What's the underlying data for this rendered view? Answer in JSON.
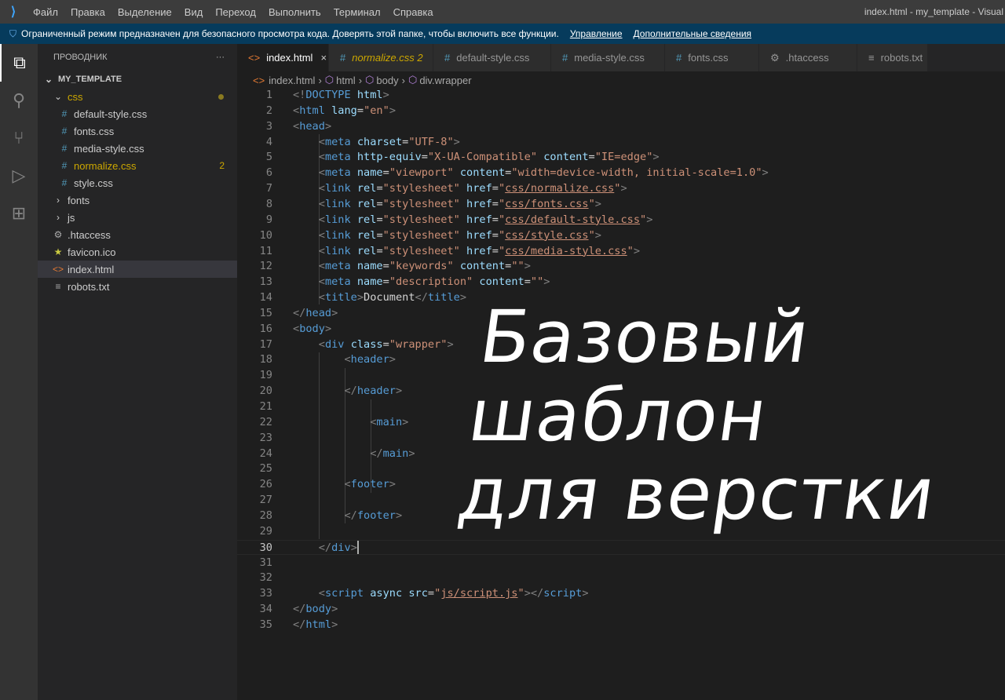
{
  "titlebar": {
    "menu": [
      "Файл",
      "Правка",
      "Выделение",
      "Вид",
      "Переход",
      "Выполнить",
      "Терминал",
      "Справка"
    ],
    "title": "index.html - my_template - Visual"
  },
  "banner": {
    "text": "Ограниченный режим предназначен для безопасного просмотра кода. Доверять этой папке, чтобы включить все функции.",
    "manage": "Управление",
    "more": "Дополнительные сведения"
  },
  "sidebar": {
    "title": "ПРОВОДНИК",
    "more": "···",
    "root": "MY_TEMPLATE",
    "items": [
      {
        "label": "css",
        "kind": "folder-open",
        "level": 1,
        "modified": true
      },
      {
        "label": "default-style.css",
        "kind": "css",
        "level": 2
      },
      {
        "label": "fonts.css",
        "kind": "css",
        "level": 2
      },
      {
        "label": "media-style.css",
        "kind": "css",
        "level": 2
      },
      {
        "label": "normalize.css",
        "kind": "css",
        "level": 2,
        "badge": "2"
      },
      {
        "label": "style.css",
        "kind": "css",
        "level": 2
      },
      {
        "label": "fonts",
        "kind": "folder",
        "level": 1
      },
      {
        "label": "js",
        "kind": "folder",
        "level": 1
      },
      {
        "label": ".htaccess",
        "kind": "gear",
        "level": 1
      },
      {
        "label": "favicon.ico",
        "kind": "star",
        "level": 1
      },
      {
        "label": "index.html",
        "kind": "html",
        "level": 1,
        "selected": true
      },
      {
        "label": "robots.txt",
        "kind": "txt",
        "level": 1
      }
    ]
  },
  "tabs": [
    {
      "label": "index.html",
      "icon": "html",
      "active": true,
      "close": "×"
    },
    {
      "label": "normalize.css 2",
      "icon": "css",
      "modified": true
    },
    {
      "label": "default-style.css",
      "icon": "css"
    },
    {
      "label": "media-style.css",
      "icon": "css"
    },
    {
      "label": "fonts.css",
      "icon": "css"
    },
    {
      "label": ".htaccess",
      "icon": "gear"
    },
    {
      "label": "robots.txt",
      "icon": "txt"
    }
  ],
  "breadcrumb": [
    "index.html",
    "html",
    "body",
    "div.wrapper"
  ],
  "editor": {
    "current_line": 30,
    "lines": [
      [
        [
          "b",
          "<!"
        ],
        [
          "t",
          "DOCTYPE"
        ],
        [
          "p",
          " "
        ],
        [
          "a",
          "html"
        ],
        [
          "b",
          ">"
        ]
      ],
      [
        [
          "b",
          "<"
        ],
        [
          "t",
          "html"
        ],
        [
          "p",
          " "
        ],
        [
          "a",
          "lang"
        ],
        [
          "p",
          "="
        ],
        [
          "s",
          "\"en\""
        ],
        [
          "b",
          ">"
        ]
      ],
      [
        [
          "b",
          "<"
        ],
        [
          "t",
          "head"
        ],
        [
          "b",
          ">"
        ]
      ],
      [
        [
          "p",
          "    "
        ],
        [
          "b",
          "<"
        ],
        [
          "t",
          "meta"
        ],
        [
          "p",
          " "
        ],
        [
          "a",
          "charset"
        ],
        [
          "p",
          "="
        ],
        [
          "s",
          "\"UTF-8\""
        ],
        [
          "b",
          ">"
        ]
      ],
      [
        [
          "p",
          "    "
        ],
        [
          "b",
          "<"
        ],
        [
          "t",
          "meta"
        ],
        [
          "p",
          " "
        ],
        [
          "a",
          "http-equiv"
        ],
        [
          "p",
          "="
        ],
        [
          "s",
          "\"X-UA-Compatible\""
        ],
        [
          "p",
          " "
        ],
        [
          "a",
          "content"
        ],
        [
          "p",
          "="
        ],
        [
          "s",
          "\"IE=edge\""
        ],
        [
          "b",
          ">"
        ]
      ],
      [
        [
          "p",
          "    "
        ],
        [
          "b",
          "<"
        ],
        [
          "t",
          "meta"
        ],
        [
          "p",
          " "
        ],
        [
          "a",
          "name"
        ],
        [
          "p",
          "="
        ],
        [
          "s",
          "\"viewport\""
        ],
        [
          "p",
          " "
        ],
        [
          "a",
          "content"
        ],
        [
          "p",
          "="
        ],
        [
          "s",
          "\"width=device-width, initial-scale=1.0\""
        ],
        [
          "b",
          ">"
        ]
      ],
      [
        [
          "p",
          "    "
        ],
        [
          "b",
          "<"
        ],
        [
          "t",
          "link"
        ],
        [
          "p",
          " "
        ],
        [
          "a",
          "rel"
        ],
        [
          "p",
          "="
        ],
        [
          "s",
          "\"stylesheet\""
        ],
        [
          "p",
          " "
        ],
        [
          "a",
          "href"
        ],
        [
          "p",
          "="
        ],
        [
          "s",
          "\""
        ],
        [
          "u",
          "css/normalize.css"
        ],
        [
          "s",
          "\""
        ],
        [
          "b",
          ">"
        ]
      ],
      [
        [
          "p",
          "    "
        ],
        [
          "b",
          "<"
        ],
        [
          "t",
          "link"
        ],
        [
          "p",
          " "
        ],
        [
          "a",
          "rel"
        ],
        [
          "p",
          "="
        ],
        [
          "s",
          "\"stylesheet\""
        ],
        [
          "p",
          " "
        ],
        [
          "a",
          "href"
        ],
        [
          "p",
          "="
        ],
        [
          "s",
          "\""
        ],
        [
          "u",
          "css/fonts.css"
        ],
        [
          "s",
          "\""
        ],
        [
          "b",
          ">"
        ]
      ],
      [
        [
          "p",
          "    "
        ],
        [
          "b",
          "<"
        ],
        [
          "t",
          "link"
        ],
        [
          "p",
          " "
        ],
        [
          "a",
          "rel"
        ],
        [
          "p",
          "="
        ],
        [
          "s",
          "\"stylesheet\""
        ],
        [
          "p",
          " "
        ],
        [
          "a",
          "href"
        ],
        [
          "p",
          "="
        ],
        [
          "s",
          "\""
        ],
        [
          "u",
          "css/default-style.css"
        ],
        [
          "s",
          "\""
        ],
        [
          "b",
          ">"
        ]
      ],
      [
        [
          "p",
          "    "
        ],
        [
          "b",
          "<"
        ],
        [
          "t",
          "link"
        ],
        [
          "p",
          " "
        ],
        [
          "a",
          "rel"
        ],
        [
          "p",
          "="
        ],
        [
          "s",
          "\"stylesheet\""
        ],
        [
          "p",
          " "
        ],
        [
          "a",
          "href"
        ],
        [
          "p",
          "="
        ],
        [
          "s",
          "\""
        ],
        [
          "u",
          "css/style.css"
        ],
        [
          "s",
          "\""
        ],
        [
          "b",
          ">"
        ]
      ],
      [
        [
          "p",
          "    "
        ],
        [
          "b",
          "<"
        ],
        [
          "t",
          "link"
        ],
        [
          "p",
          " "
        ],
        [
          "a",
          "rel"
        ],
        [
          "p",
          "="
        ],
        [
          "s",
          "\"stylesheet\""
        ],
        [
          "p",
          " "
        ],
        [
          "a",
          "href"
        ],
        [
          "p",
          "="
        ],
        [
          "s",
          "\""
        ],
        [
          "u",
          "css/media-style.css"
        ],
        [
          "s",
          "\""
        ],
        [
          "b",
          ">"
        ]
      ],
      [
        [
          "p",
          "    "
        ],
        [
          "b",
          "<"
        ],
        [
          "t",
          "meta"
        ],
        [
          "p",
          " "
        ],
        [
          "a",
          "name"
        ],
        [
          "p",
          "="
        ],
        [
          "s",
          "\"keywords\""
        ],
        [
          "p",
          " "
        ],
        [
          "a",
          "content"
        ],
        [
          "p",
          "="
        ],
        [
          "s",
          "\"\""
        ],
        [
          "b",
          ">"
        ]
      ],
      [
        [
          "p",
          "    "
        ],
        [
          "b",
          "<"
        ],
        [
          "t",
          "meta"
        ],
        [
          "p",
          " "
        ],
        [
          "a",
          "name"
        ],
        [
          "p",
          "="
        ],
        [
          "s",
          "\"description\""
        ],
        [
          "p",
          " "
        ],
        [
          "a",
          "content"
        ],
        [
          "p",
          "="
        ],
        [
          "s",
          "\"\""
        ],
        [
          "b",
          ">"
        ]
      ],
      [
        [
          "p",
          "    "
        ],
        [
          "b",
          "<"
        ],
        [
          "t",
          "title"
        ],
        [
          "b",
          ">"
        ],
        [
          "p",
          "Document"
        ],
        [
          "b",
          "</"
        ],
        [
          "t",
          "title"
        ],
        [
          "b",
          ">"
        ]
      ],
      [
        [
          "b",
          "</"
        ],
        [
          "t",
          "head"
        ],
        [
          "b",
          ">"
        ]
      ],
      [
        [
          "b",
          "<"
        ],
        [
          "t",
          "body"
        ],
        [
          "b",
          ">"
        ]
      ],
      [
        [
          "p",
          "    "
        ],
        [
          "b",
          "<"
        ],
        [
          "t",
          "div"
        ],
        [
          "p",
          " "
        ],
        [
          "a",
          "class"
        ],
        [
          "p",
          "="
        ],
        [
          "s",
          "\"wrapper\""
        ],
        [
          "b",
          ">"
        ]
      ],
      [
        [
          "p",
          "        "
        ],
        [
          "b",
          "<"
        ],
        [
          "t",
          "header"
        ],
        [
          "b",
          ">"
        ]
      ],
      [],
      [
        [
          "p",
          "        "
        ],
        [
          "b",
          "</"
        ],
        [
          "t",
          "header"
        ],
        [
          "b",
          ">"
        ]
      ],
      [],
      [
        [
          "p",
          "            "
        ],
        [
          "b",
          "<"
        ],
        [
          "t",
          "main"
        ],
        [
          "b",
          ">"
        ]
      ],
      [],
      [
        [
          "p",
          "            "
        ],
        [
          "b",
          "</"
        ],
        [
          "t",
          "main"
        ],
        [
          "b",
          ">"
        ]
      ],
      [],
      [
        [
          "p",
          "        "
        ],
        [
          "b",
          "<"
        ],
        [
          "t",
          "footer"
        ],
        [
          "b",
          ">"
        ]
      ],
      [],
      [
        [
          "p",
          "        "
        ],
        [
          "b",
          "</"
        ],
        [
          "t",
          "footer"
        ],
        [
          "b",
          ">"
        ]
      ],
      [],
      [
        [
          "p",
          "    "
        ],
        [
          "b",
          "</"
        ],
        [
          "t",
          "div"
        ],
        [
          "b",
          ">"
        ]
      ],
      [],
      [],
      [
        [
          "p",
          "    "
        ],
        [
          "b",
          "<"
        ],
        [
          "t",
          "script"
        ],
        [
          "p",
          " "
        ],
        [
          "a",
          "async"
        ],
        [
          "p",
          " "
        ],
        [
          "a",
          "src"
        ],
        [
          "p",
          "="
        ],
        [
          "s",
          "\""
        ],
        [
          "u",
          "js/script.js"
        ],
        [
          "s",
          "\""
        ],
        [
          "b",
          "></"
        ],
        [
          "t",
          "script"
        ],
        [
          "b",
          ">"
        ]
      ],
      [
        [
          "b",
          "</"
        ],
        [
          "t",
          "body"
        ],
        [
          "b",
          ">"
        ]
      ],
      [
        [
          "b",
          "</"
        ],
        [
          "t",
          "html"
        ],
        [
          "b",
          ">"
        ]
      ]
    ]
  },
  "overlay": [
    "Базовый",
    "шаблон",
    "для верстки"
  ]
}
